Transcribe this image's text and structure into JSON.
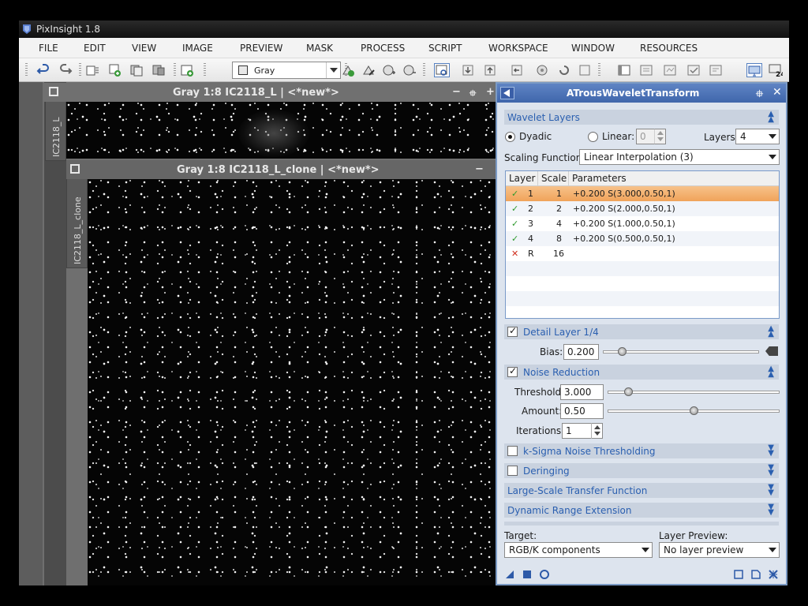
{
  "app": {
    "title": "PixInsight 1.8"
  },
  "menu": [
    "FILE",
    "EDIT",
    "VIEW",
    "IMAGE",
    "PREVIEW",
    "MASK",
    "PROCESS",
    "SCRIPT",
    "WORKSPACE",
    "WINDOW",
    "RESOURCES"
  ],
  "toolbar": {
    "color_space_select": "Gray",
    "icons": [
      "undo-icon",
      "redo-icon",
      "new-image-icon",
      "duplicate-image-icon",
      "copy-image-icon",
      "paste-image-icon",
      "new-preview-icon",
      "new-process-icon",
      "edit-process-icon",
      "add-process-icon",
      "remove-process-icon",
      "zoom-preview-icon",
      "download-icon",
      "upload-icon",
      "undo-process-icon",
      "settings-icon",
      "reset-icon",
      "layout-icon",
      "explorer-icon",
      "monitor-icon",
      "frame-counter-icon"
    ]
  },
  "windows": {
    "img1": {
      "title": "Gray 1:8 IC2118_L | <*new*>",
      "tab": "IC2118_L"
    },
    "img2": {
      "title": "Gray 1:8 IC2118_L_clone | <*new*>",
      "tab": "IC2118_L_clone"
    }
  },
  "panel": {
    "title": "ATrousWaveletTransform",
    "wavelet_layers": {
      "section": "Wavelet Layers",
      "dyadic": "Dyadic",
      "linear": "Linear:",
      "linear_value": "0",
      "layers_label": "Layers:",
      "layers_value": "4",
      "scaling_label": "Scaling Function:",
      "scaling_value": "Linear Interpolation (3)",
      "columns": [
        "Layer",
        "Scale",
        "Parameters"
      ],
      "rows": [
        {
          "enabled": true,
          "layer": "1",
          "scale": "1",
          "params": "+0.200 S(3.000,0.50,1)",
          "selected": true
        },
        {
          "enabled": true,
          "layer": "2",
          "scale": "2",
          "params": "+0.200 S(2.000,0.50,1)",
          "selected": false
        },
        {
          "enabled": true,
          "layer": "3",
          "scale": "4",
          "params": "+0.200 S(1.000,0.50,1)",
          "selected": false
        },
        {
          "enabled": true,
          "layer": "4",
          "scale": "8",
          "params": "+0.200 S(0.500,0.50,1)",
          "selected": false
        },
        {
          "enabled": false,
          "layer": "R",
          "scale": "16",
          "params": "",
          "selected": false
        }
      ]
    },
    "detail_layer": {
      "section": "Detail Layer 1/4",
      "bias_label": "Bias:",
      "bias_value": "0.200",
      "bias_level": 0.1
    },
    "noise_reduction": {
      "section": "Noise Reduction",
      "threshold_label": "Threshold:",
      "threshold_value": "3.000",
      "threshold_level": 0.1,
      "amount_label": "Amount:",
      "amount_value": "0.50",
      "amount_level": 0.5,
      "iterations_label": "Iterations:",
      "iterations_value": "1"
    },
    "sections_collapsed": [
      "k-Sigma Noise Thresholding",
      "Deringing",
      "Large-Scale Transfer Function",
      "Dynamic Range Extension"
    ],
    "target": {
      "label": "Target:",
      "value": "RGB/K components"
    },
    "layer_preview": {
      "label": "Layer Preview:",
      "value": "No layer preview"
    }
  },
  "colors": {
    "accent": "#3f66ab",
    "section_text": "#2a5fb0",
    "selection": "#f0a35a"
  }
}
